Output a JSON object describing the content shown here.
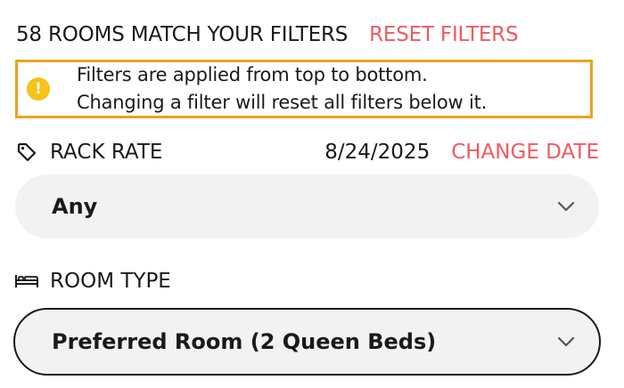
{
  "filters_header": {
    "results_text": "58 ROOMS MATCH YOUR FILTERS",
    "reset_label": "RESET FILTERS"
  },
  "notice": {
    "icon": "exclamation-icon",
    "line1": "Filters are applied from top to bottom.",
    "line2": "Changing a filter will reset all filters below it."
  },
  "rack_rate": {
    "icon": "price-tag-icon",
    "label": "RACK RATE",
    "date": "8/24/2025",
    "change_date_label": "CHANGE DATE",
    "selected": "Any"
  },
  "room_type": {
    "icon": "bed-icon",
    "label": "ROOM TYPE",
    "selected": "Preferred Room (2 Queen Beds)"
  },
  "colors": {
    "accent_link": "#ef5a63",
    "notice_border": "#e9a320",
    "notice_icon": "#f7c21a",
    "select_bg": "#f2f2f2"
  }
}
